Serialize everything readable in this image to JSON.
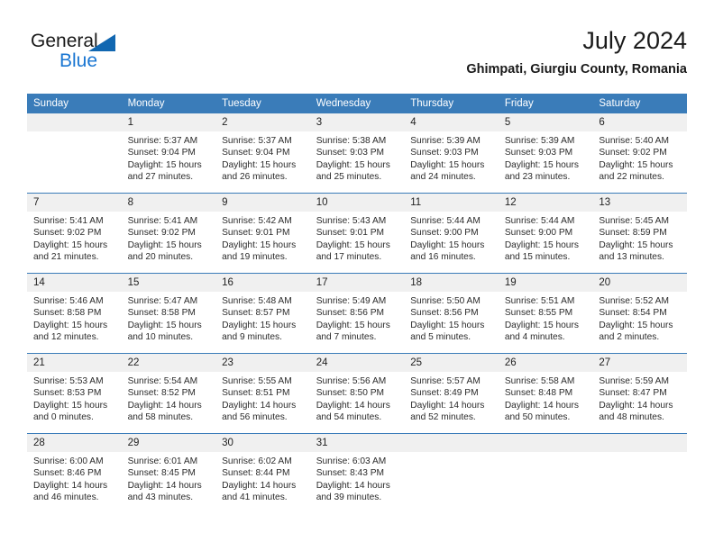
{
  "brand": {
    "word_one": "General",
    "word_two": "Blue",
    "triangle_color": "#1167b1",
    "blue_text_color": "#1a76d2"
  },
  "header": {
    "title": "July 2024",
    "location": "Ghimpati, Giurgiu County, Romania"
  },
  "theme": {
    "header_blue": "#3a7cb9",
    "daynum_gray": "#f0f0f0",
    "separator_blue": "#3a7cb9",
    "text": "#222222"
  },
  "weekdays": [
    "Sunday",
    "Monday",
    "Tuesday",
    "Wednesday",
    "Thursday",
    "Friday",
    "Saturday"
  ],
  "labels": {
    "sunrise_prefix": "Sunrise:",
    "sunset_prefix": "Sunset:",
    "daylight_prefix": "Daylight:"
  },
  "weeks": [
    [
      {
        "day": "",
        "sunrise": "",
        "sunset": "",
        "daylight_line1": "",
        "daylight_line2": ""
      },
      {
        "day": "1",
        "sunrise": "Sunrise: 5:37 AM",
        "sunset": "Sunset: 9:04 PM",
        "daylight_line1": "Daylight: 15 hours",
        "daylight_line2": "and 27 minutes."
      },
      {
        "day": "2",
        "sunrise": "Sunrise: 5:37 AM",
        "sunset": "Sunset: 9:04 PM",
        "daylight_line1": "Daylight: 15 hours",
        "daylight_line2": "and 26 minutes."
      },
      {
        "day": "3",
        "sunrise": "Sunrise: 5:38 AM",
        "sunset": "Sunset: 9:03 PM",
        "daylight_line1": "Daylight: 15 hours",
        "daylight_line2": "and 25 minutes."
      },
      {
        "day": "4",
        "sunrise": "Sunrise: 5:39 AM",
        "sunset": "Sunset: 9:03 PM",
        "daylight_line1": "Daylight: 15 hours",
        "daylight_line2": "and 24 minutes."
      },
      {
        "day": "5",
        "sunrise": "Sunrise: 5:39 AM",
        "sunset": "Sunset: 9:03 PM",
        "daylight_line1": "Daylight: 15 hours",
        "daylight_line2": "and 23 minutes."
      },
      {
        "day": "6",
        "sunrise": "Sunrise: 5:40 AM",
        "sunset": "Sunset: 9:02 PM",
        "daylight_line1": "Daylight: 15 hours",
        "daylight_line2": "and 22 minutes."
      }
    ],
    [
      {
        "day": "7",
        "sunrise": "Sunrise: 5:41 AM",
        "sunset": "Sunset: 9:02 PM",
        "daylight_line1": "Daylight: 15 hours",
        "daylight_line2": "and 21 minutes."
      },
      {
        "day": "8",
        "sunrise": "Sunrise: 5:41 AM",
        "sunset": "Sunset: 9:02 PM",
        "daylight_line1": "Daylight: 15 hours",
        "daylight_line2": "and 20 minutes."
      },
      {
        "day": "9",
        "sunrise": "Sunrise: 5:42 AM",
        "sunset": "Sunset: 9:01 PM",
        "daylight_line1": "Daylight: 15 hours",
        "daylight_line2": "and 19 minutes."
      },
      {
        "day": "10",
        "sunrise": "Sunrise: 5:43 AM",
        "sunset": "Sunset: 9:01 PM",
        "daylight_line1": "Daylight: 15 hours",
        "daylight_line2": "and 17 minutes."
      },
      {
        "day": "11",
        "sunrise": "Sunrise: 5:44 AM",
        "sunset": "Sunset: 9:00 PM",
        "daylight_line1": "Daylight: 15 hours",
        "daylight_line2": "and 16 minutes."
      },
      {
        "day": "12",
        "sunrise": "Sunrise: 5:44 AM",
        "sunset": "Sunset: 9:00 PM",
        "daylight_line1": "Daylight: 15 hours",
        "daylight_line2": "and 15 minutes."
      },
      {
        "day": "13",
        "sunrise": "Sunrise: 5:45 AM",
        "sunset": "Sunset: 8:59 PM",
        "daylight_line1": "Daylight: 15 hours",
        "daylight_line2": "and 13 minutes."
      }
    ],
    [
      {
        "day": "14",
        "sunrise": "Sunrise: 5:46 AM",
        "sunset": "Sunset: 8:58 PM",
        "daylight_line1": "Daylight: 15 hours",
        "daylight_line2": "and 12 minutes."
      },
      {
        "day": "15",
        "sunrise": "Sunrise: 5:47 AM",
        "sunset": "Sunset: 8:58 PM",
        "daylight_line1": "Daylight: 15 hours",
        "daylight_line2": "and 10 minutes."
      },
      {
        "day": "16",
        "sunrise": "Sunrise: 5:48 AM",
        "sunset": "Sunset: 8:57 PM",
        "daylight_line1": "Daylight: 15 hours",
        "daylight_line2": "and 9 minutes."
      },
      {
        "day": "17",
        "sunrise": "Sunrise: 5:49 AM",
        "sunset": "Sunset: 8:56 PM",
        "daylight_line1": "Daylight: 15 hours",
        "daylight_line2": "and 7 minutes."
      },
      {
        "day": "18",
        "sunrise": "Sunrise: 5:50 AM",
        "sunset": "Sunset: 8:56 PM",
        "daylight_line1": "Daylight: 15 hours",
        "daylight_line2": "and 5 minutes."
      },
      {
        "day": "19",
        "sunrise": "Sunrise: 5:51 AM",
        "sunset": "Sunset: 8:55 PM",
        "daylight_line1": "Daylight: 15 hours",
        "daylight_line2": "and 4 minutes."
      },
      {
        "day": "20",
        "sunrise": "Sunrise: 5:52 AM",
        "sunset": "Sunset: 8:54 PM",
        "daylight_line1": "Daylight: 15 hours",
        "daylight_line2": "and 2 minutes."
      }
    ],
    [
      {
        "day": "21",
        "sunrise": "Sunrise: 5:53 AM",
        "sunset": "Sunset: 8:53 PM",
        "daylight_line1": "Daylight: 15 hours",
        "daylight_line2": "and 0 minutes."
      },
      {
        "day": "22",
        "sunrise": "Sunrise: 5:54 AM",
        "sunset": "Sunset: 8:52 PM",
        "daylight_line1": "Daylight: 14 hours",
        "daylight_line2": "and 58 minutes."
      },
      {
        "day": "23",
        "sunrise": "Sunrise: 5:55 AM",
        "sunset": "Sunset: 8:51 PM",
        "daylight_line1": "Daylight: 14 hours",
        "daylight_line2": "and 56 minutes."
      },
      {
        "day": "24",
        "sunrise": "Sunrise: 5:56 AM",
        "sunset": "Sunset: 8:50 PM",
        "daylight_line1": "Daylight: 14 hours",
        "daylight_line2": "and 54 minutes."
      },
      {
        "day": "25",
        "sunrise": "Sunrise: 5:57 AM",
        "sunset": "Sunset: 8:49 PM",
        "daylight_line1": "Daylight: 14 hours",
        "daylight_line2": "and 52 minutes."
      },
      {
        "day": "26",
        "sunrise": "Sunrise: 5:58 AM",
        "sunset": "Sunset: 8:48 PM",
        "daylight_line1": "Daylight: 14 hours",
        "daylight_line2": "and 50 minutes."
      },
      {
        "day": "27",
        "sunrise": "Sunrise: 5:59 AM",
        "sunset": "Sunset: 8:47 PM",
        "daylight_line1": "Daylight: 14 hours",
        "daylight_line2": "and 48 minutes."
      }
    ],
    [
      {
        "day": "28",
        "sunrise": "Sunrise: 6:00 AM",
        "sunset": "Sunset: 8:46 PM",
        "daylight_line1": "Daylight: 14 hours",
        "daylight_line2": "and 46 minutes."
      },
      {
        "day": "29",
        "sunrise": "Sunrise: 6:01 AM",
        "sunset": "Sunset: 8:45 PM",
        "daylight_line1": "Daylight: 14 hours",
        "daylight_line2": "and 43 minutes."
      },
      {
        "day": "30",
        "sunrise": "Sunrise: 6:02 AM",
        "sunset": "Sunset: 8:44 PM",
        "daylight_line1": "Daylight: 14 hours",
        "daylight_line2": "and 41 minutes."
      },
      {
        "day": "31",
        "sunrise": "Sunrise: 6:03 AM",
        "sunset": "Sunset: 8:43 PM",
        "daylight_line1": "Daylight: 14 hours",
        "daylight_line2": "and 39 minutes."
      },
      {
        "day": "",
        "sunrise": "",
        "sunset": "",
        "daylight_line1": "",
        "daylight_line2": ""
      },
      {
        "day": "",
        "sunrise": "",
        "sunset": "",
        "daylight_line1": "",
        "daylight_line2": ""
      },
      {
        "day": "",
        "sunrise": "",
        "sunset": "",
        "daylight_line1": "",
        "daylight_line2": ""
      }
    ]
  ]
}
